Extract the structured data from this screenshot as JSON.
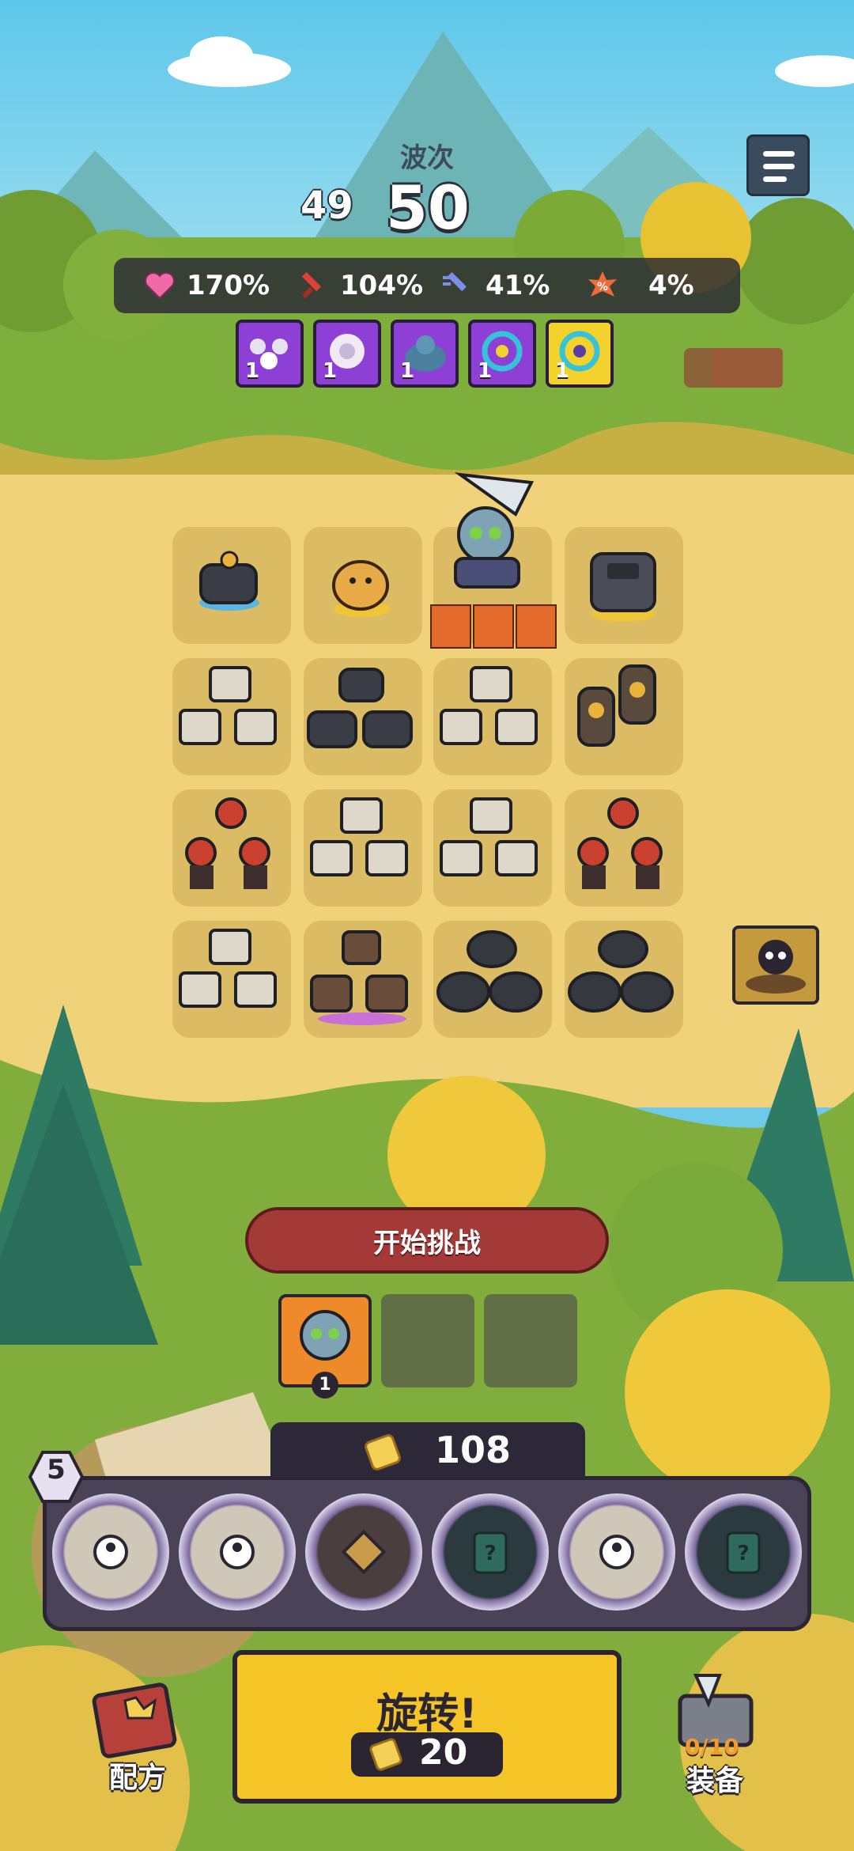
{
  "hud": {
    "wave_label": "波次",
    "wave_previous": "49",
    "wave_current": "50"
  },
  "stats": [
    {
      "icon": "heart-icon",
      "value": "170%",
      "color": "#f06aa8"
    },
    {
      "icon": "sword-icon",
      "value": "104%",
      "color": "#e0403a"
    },
    {
      "icon": "speed-sword-icon",
      "value": "41%",
      "color": "#7b8fe8"
    },
    {
      "icon": "crit-icon",
      "value": "4%",
      "color": "#ef6b35"
    }
  ],
  "buffs": [
    {
      "icon": "squad-buff-icon",
      "level": "1",
      "color": "#8e3fd6"
    },
    {
      "icon": "flower-buff-icon",
      "level": "1",
      "color": "#8e3fd6"
    },
    {
      "icon": "beast-buff-icon",
      "level": "1",
      "color": "#8e3fd6"
    },
    {
      "icon": "ring-buff-icon",
      "level": "1",
      "color": "#8e3fd6"
    },
    {
      "icon": "golden-ring-buff-icon",
      "level": "1",
      "color": "#f3d22e"
    }
  ],
  "board": {
    "rows": [
      [
        "tank-robot",
        "hamster",
        "zombie-boss",
        "armored-golem"
      ],
      [
        "box-robot-squad",
        "tank-robot-squad",
        "box-robot-squad",
        "eye-robot-pair"
      ],
      [
        "swordsman-squad",
        "box-robot-squad",
        "box-robot-squad",
        "swordsman-squad"
      ],
      [
        "box-robot-squad",
        "rifle-squad",
        "rhino-squad",
        "rhino-squad"
      ]
    ]
  },
  "actions": {
    "start_challenge": "开始挑战",
    "queue_level": "1"
  },
  "gold": "108",
  "level": "5",
  "tray_slots": [
    {
      "icon": "hero-slot-icon"
    },
    {
      "icon": "hero-slot-icon"
    },
    {
      "icon": "diamond-slot-icon"
    },
    {
      "icon": "mystery-card-icon"
    },
    {
      "icon": "hero-slot-icon"
    },
    {
      "icon": "mystery-card-icon"
    }
  ],
  "spin": {
    "label": "旋转!",
    "cost": "20"
  },
  "recipes_label": "配方",
  "equipment": {
    "label": "装备",
    "count": "0/10"
  }
}
